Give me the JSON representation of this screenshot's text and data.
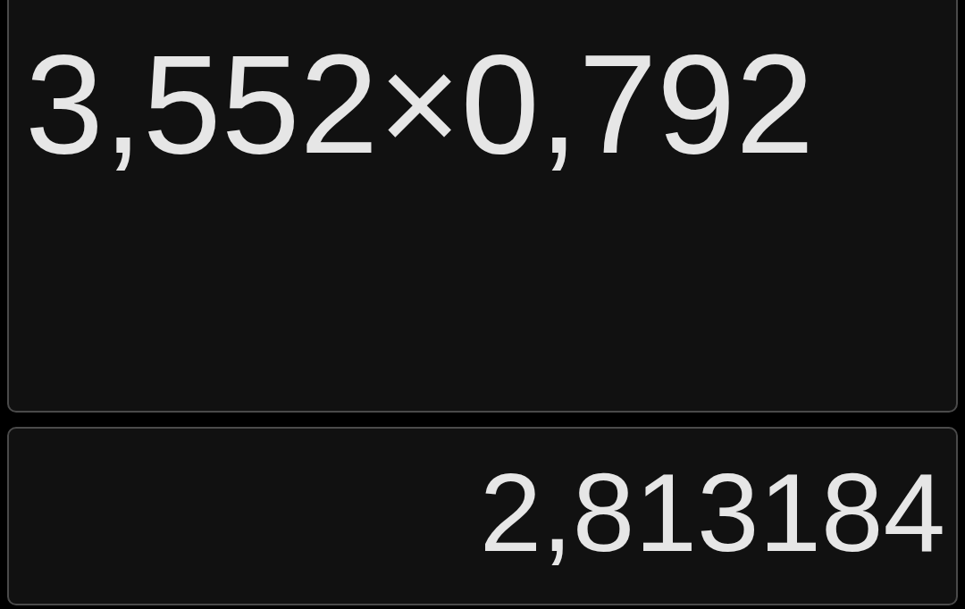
{
  "expression": "3,552×0,792",
  "result": "2,813184"
}
